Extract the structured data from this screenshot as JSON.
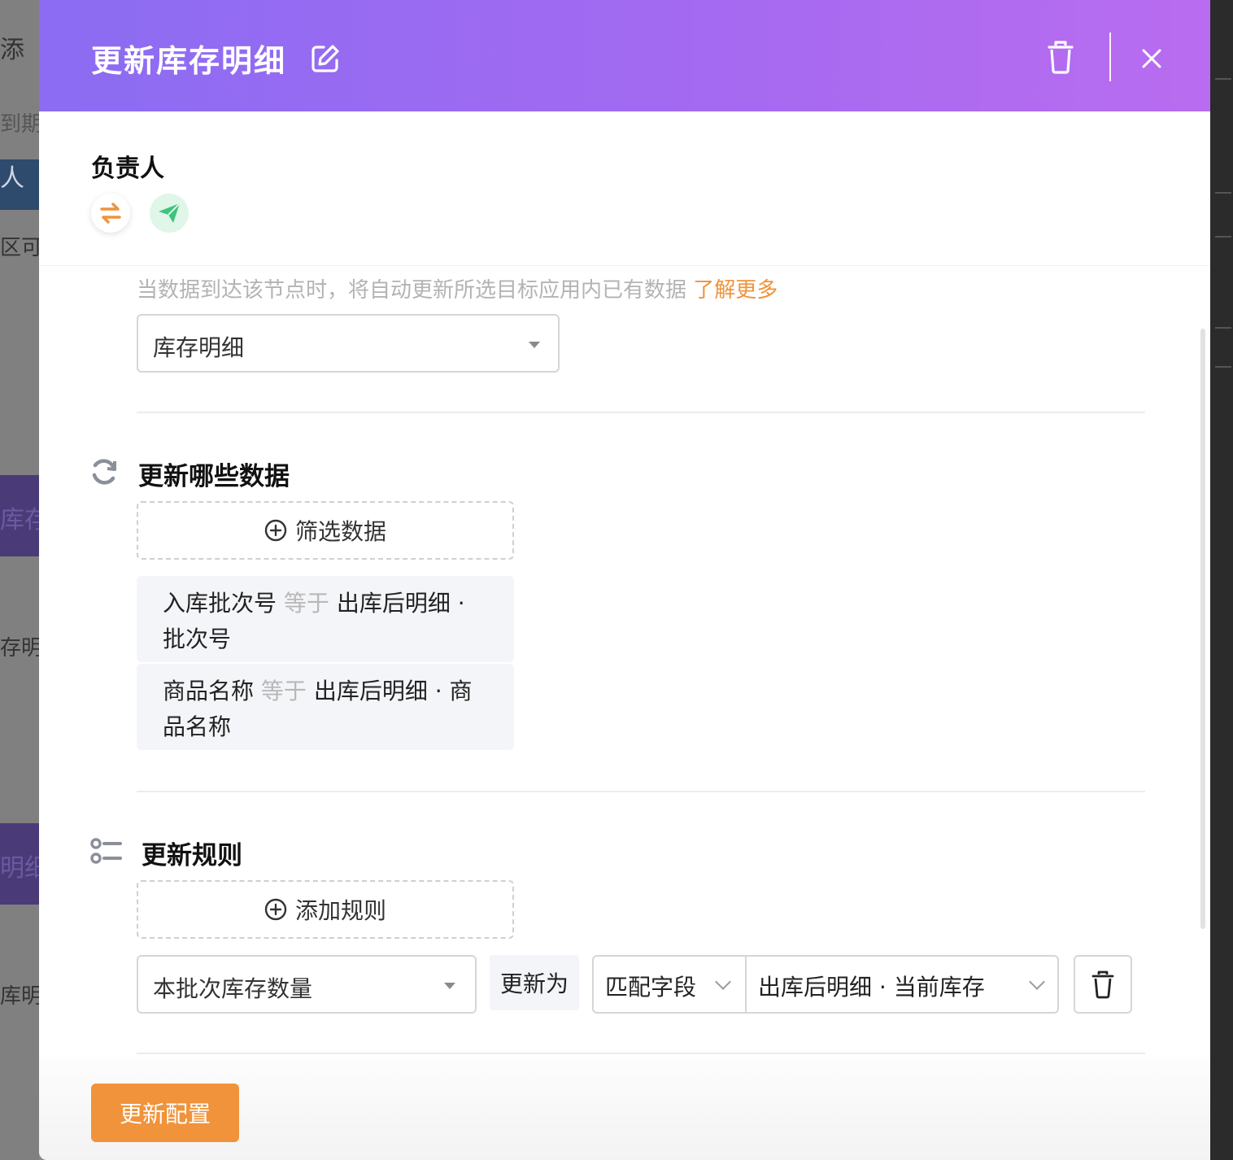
{
  "background": {
    "fragments": [
      "添",
      "到期",
      "人",
      "区可",
      "库存",
      "存明",
      "明细",
      "库明"
    ]
  },
  "drawer": {
    "title": "更新库存明细",
    "owner_label": "负责人",
    "hint_text": "当数据到达该节点时，将自动更新所选目标应用内已有数据",
    "learn_more": "了解更多",
    "target_app": "库存明细",
    "section_data": {
      "title": "更新哪些数据",
      "filter_button": "筛选数据",
      "conditions": [
        {
          "field": "入库批次号",
          "op": "等于",
          "value": "出库后明细 · 批次号"
        },
        {
          "field": "商品名称",
          "op": "等于",
          "value": "出库后明细 · 商品名称"
        }
      ]
    },
    "section_rules": {
      "title": "更新规则",
      "add_button": "添加规则",
      "rule": {
        "field": "本批次库存数量",
        "update_as": "更新为",
        "mode": "匹配字段",
        "source": "出库后明细 · 当前库存"
      }
    },
    "submit_button": "更新配置"
  },
  "colors": {
    "header_gradient_start": "#8b6cf2",
    "header_gradient_end": "#b96cf0",
    "accent_orange": "#f0933a",
    "send_green": "#3ec37a"
  },
  "icons": {
    "edit": "edit-icon",
    "trash": "trash-icon",
    "close": "close-icon",
    "swap": "swap-icon",
    "send": "paper-plane-icon",
    "refresh": "refresh-icon",
    "rules": "list-icon",
    "plus": "plus-circle-icon"
  }
}
